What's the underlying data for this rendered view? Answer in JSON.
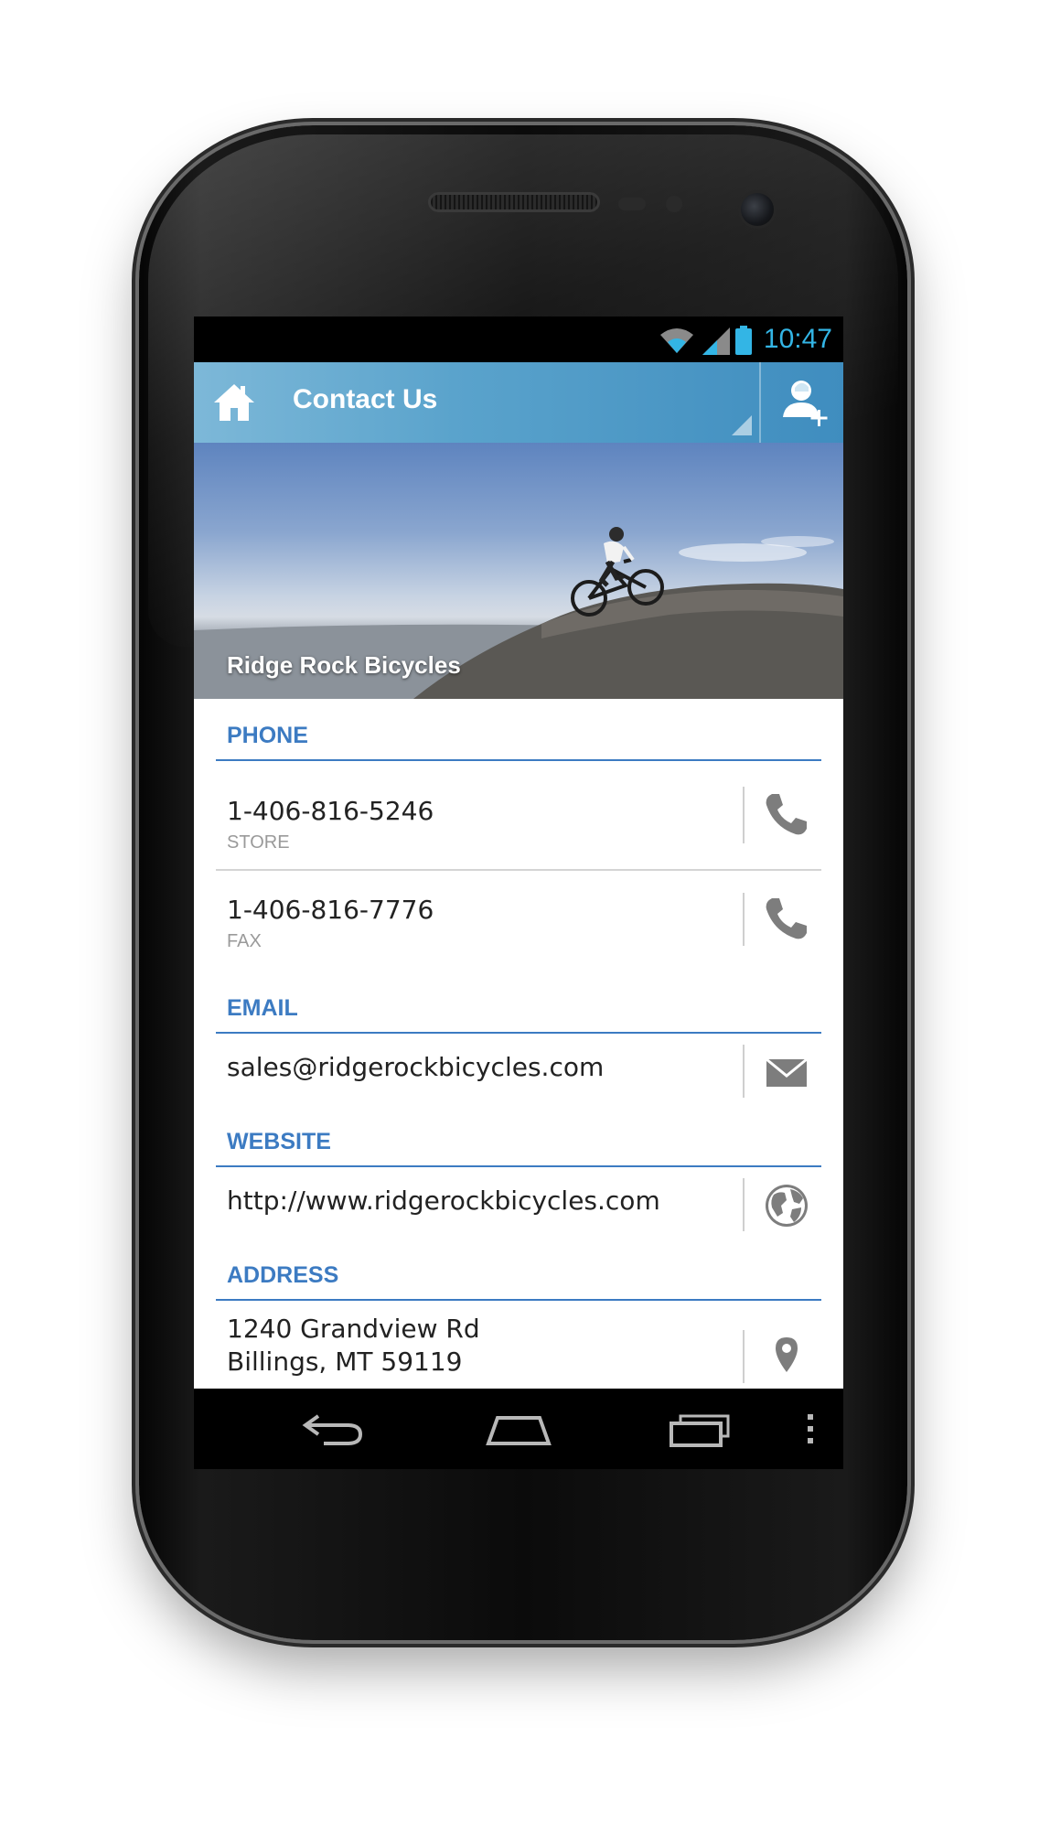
{
  "status_bar": {
    "time": "10:47",
    "icons": [
      "wifi-icon",
      "signal-icon",
      "battery-icon"
    ]
  },
  "action_bar": {
    "title": "Contact Us",
    "home_icon": "home-icon",
    "add_icon": "add-contact-icon"
  },
  "hero": {
    "caption": "Ridge Rock Bicycles"
  },
  "sections": {
    "phone": {
      "heading": "PHONE",
      "items": [
        {
          "value": "1-406-816-5246",
          "label": "STORE",
          "icon": "phone-icon"
        },
        {
          "value": "1-406-816-7776",
          "label": "FAX",
          "icon": "phone-icon"
        }
      ]
    },
    "email": {
      "heading": "EMAIL",
      "value": "sales@ridgerockbicycles.com",
      "icon": "mail-icon"
    },
    "website": {
      "heading": "WEBSITE",
      "value": "http://www.ridgerockbicycles.com",
      "icon": "globe-icon"
    },
    "address": {
      "heading": "ADDRESS",
      "line1": "1240 Grandview Rd",
      "line2": "Billings, MT 59119",
      "icon": "map-pin-icon"
    }
  },
  "nav_bar": {
    "icons": [
      "back-icon",
      "home-nav-icon",
      "recents-icon",
      "overflow-menu-icon"
    ]
  },
  "colors": {
    "accent": "#3c7bc2",
    "status_clock": "#33b5e5",
    "action_bar": "#5aa3cc"
  }
}
